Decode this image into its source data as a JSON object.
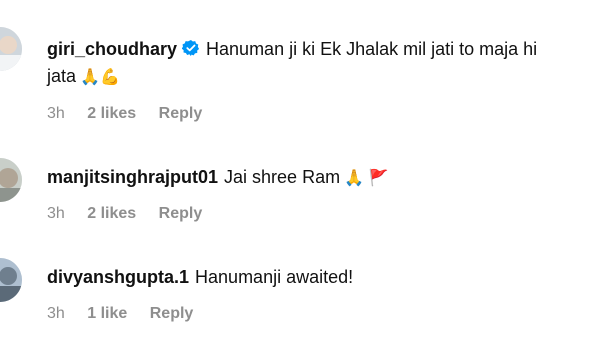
{
  "comments": [
    {
      "username": "giri_choudhary",
      "verified": true,
      "text_line1": "Hanuman ji ki Ek Jhalak mil jati to maja hi",
      "text_line2": "jata",
      "emojis": "🙏💪",
      "time": "3h",
      "likes": "2 likes",
      "reply": "Reply"
    },
    {
      "username": "manjitsinghrajput01",
      "verified": false,
      "text_line1": "Jai shree Ram",
      "emojis": "🙏 🚩",
      "time": "3h",
      "likes": "2 likes",
      "reply": "Reply"
    },
    {
      "username": "divyanshgupta.1",
      "verified": false,
      "text_line1": "Hanumanji awaited!",
      "time": "3h",
      "likes": "1 like",
      "reply": "Reply"
    }
  ],
  "colors": {
    "meta_gray": "#8e8e8e",
    "verified_blue": "#0095f6"
  }
}
